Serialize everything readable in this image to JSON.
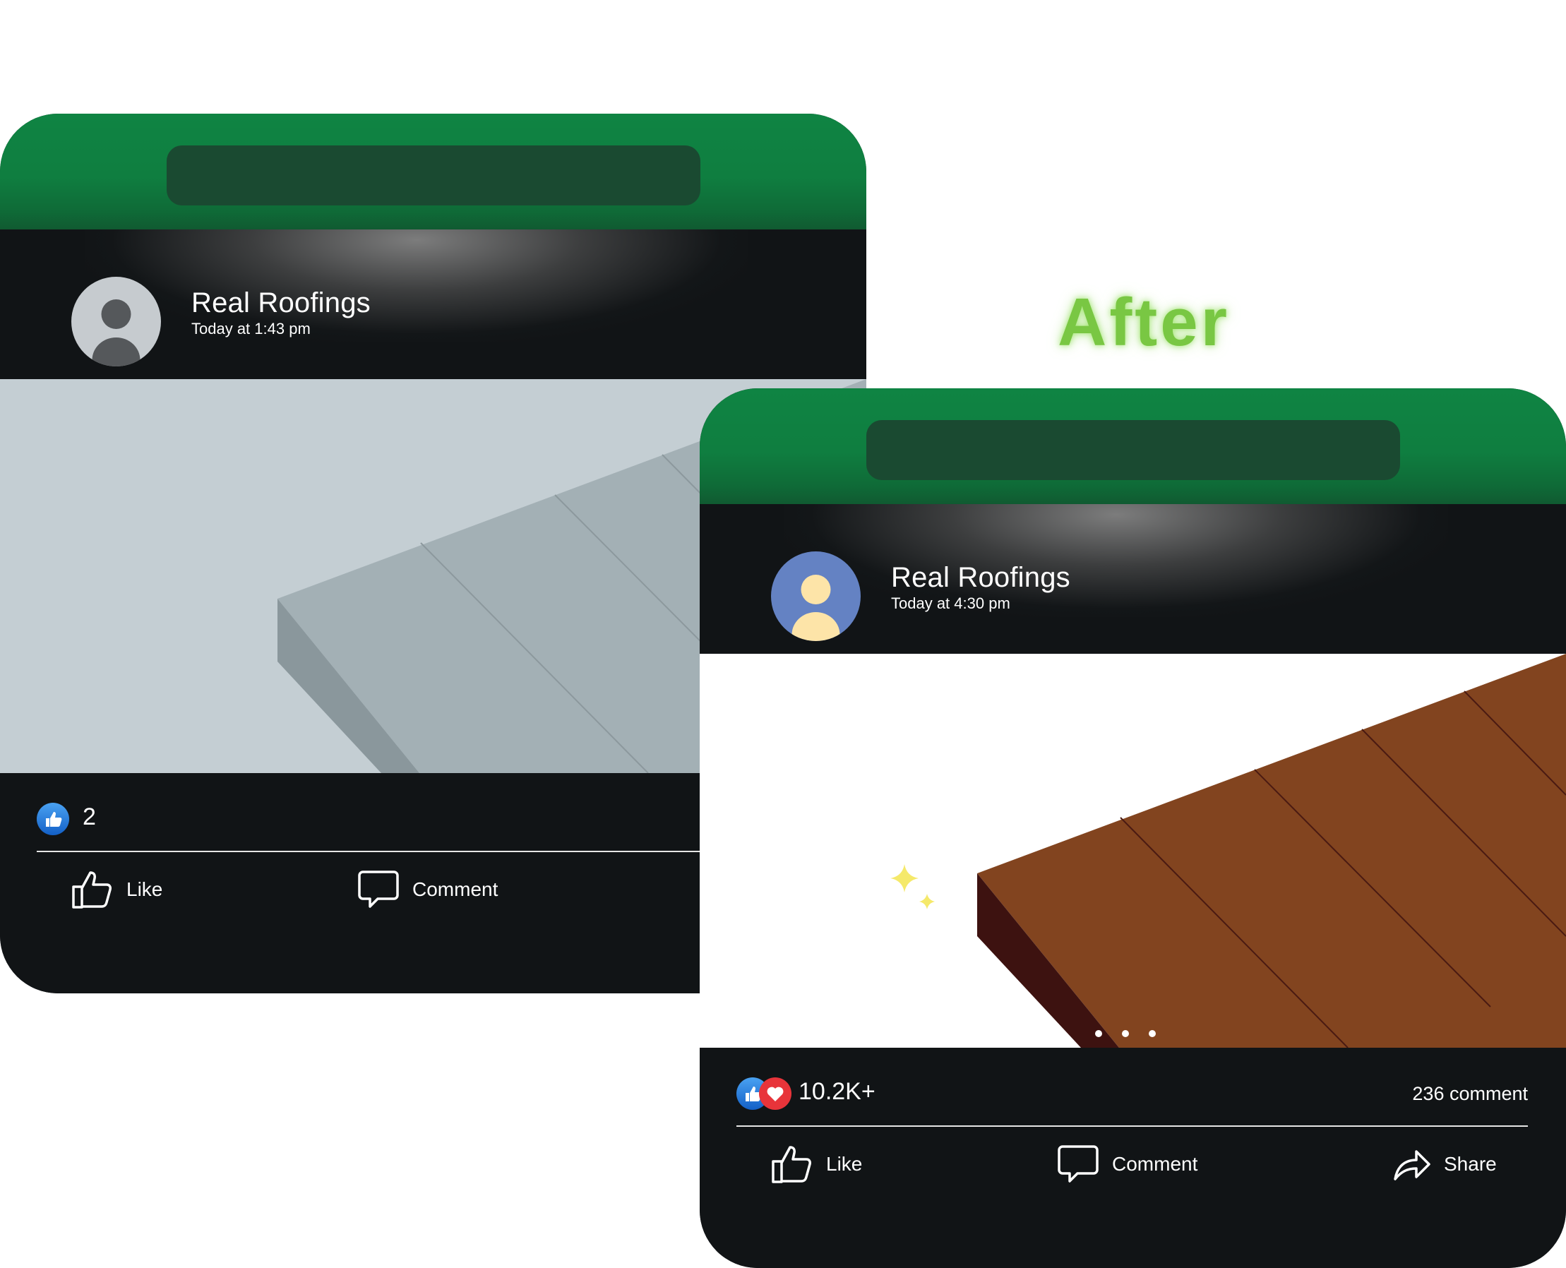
{
  "label": "After",
  "before": {
    "author": "Real Roofings",
    "time": "Today at 1:43 pm",
    "reactions": "2",
    "actions": {
      "like": "Like",
      "comment": "Comment"
    },
    "colors": {
      "roof": "#a3b0b5",
      "roof_edge": "#8a979c",
      "background": "#c4ced3"
    }
  },
  "after": {
    "author": "Real Roofings",
    "time": "Today at 4:30 pm",
    "reactions": "10.2K+",
    "comments": "236 comment",
    "actions": {
      "like": "Like",
      "comment": "Comment",
      "share": "Share"
    },
    "colors": {
      "roof": "#82441f",
      "roof_edge": "#3d1210",
      "avatar_bg": "#6482c3"
    }
  }
}
